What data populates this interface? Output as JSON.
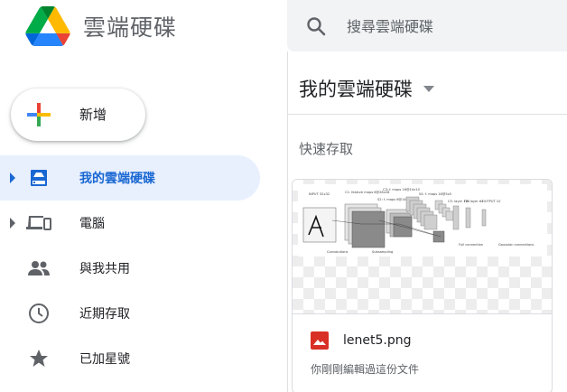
{
  "app": {
    "name": "雲端硬碟",
    "logo_icon": "google-drive-logo"
  },
  "search": {
    "placeholder": "搜尋雲端硬碟",
    "value": "",
    "icon": "search-icon"
  },
  "new_button": {
    "label": "新增",
    "icon": "plus-multicolor-icon"
  },
  "sidebar": {
    "items": [
      {
        "label": "我的雲端硬碟",
        "icon": "my-drive-icon",
        "active": true,
        "expandable": true
      },
      {
        "label": "電腦",
        "icon": "computers-icon",
        "active": false,
        "expandable": true
      },
      {
        "label": "與我共用",
        "icon": "shared-people-icon",
        "active": false,
        "expandable": false
      },
      {
        "label": "近期存取",
        "icon": "clock-icon",
        "active": false,
        "expandable": false
      },
      {
        "label": "已加星號",
        "icon": "star-icon",
        "active": false,
        "expandable": false
      }
    ]
  },
  "main": {
    "title": "我的雲端硬碟",
    "quick_access_title": "快速存取",
    "quick_access": [
      {
        "file_name": "lenet5.png",
        "file_type_icon": "image-file-icon",
        "subtitle": "你剛剛編輯過這份文件",
        "thumbnail_labels": {
          "input": "INPUT\n32x32",
          "c1": "C1: feature maps\n6@28x28",
          "c3": "C3: f. maps 16@10x10",
          "s2": "S2: f. maps\n6@14x14",
          "s4": "S4: f. maps 16@5x5",
          "c5": "C5: layer\n120",
          "f6": "F6: layer\n84",
          "output": "OUTPUT\n10",
          "convolutions": "Convolutions",
          "subsampling": "Subsampling",
          "full_connection": "Full connection",
          "gaussian_connections": "Gaussian connections"
        }
      }
    ]
  },
  "colors": {
    "accent": "#1967d2",
    "active_bg": "#e8f0fe",
    "search_bg": "#f1f3f4",
    "image_icon": "#d93025"
  }
}
